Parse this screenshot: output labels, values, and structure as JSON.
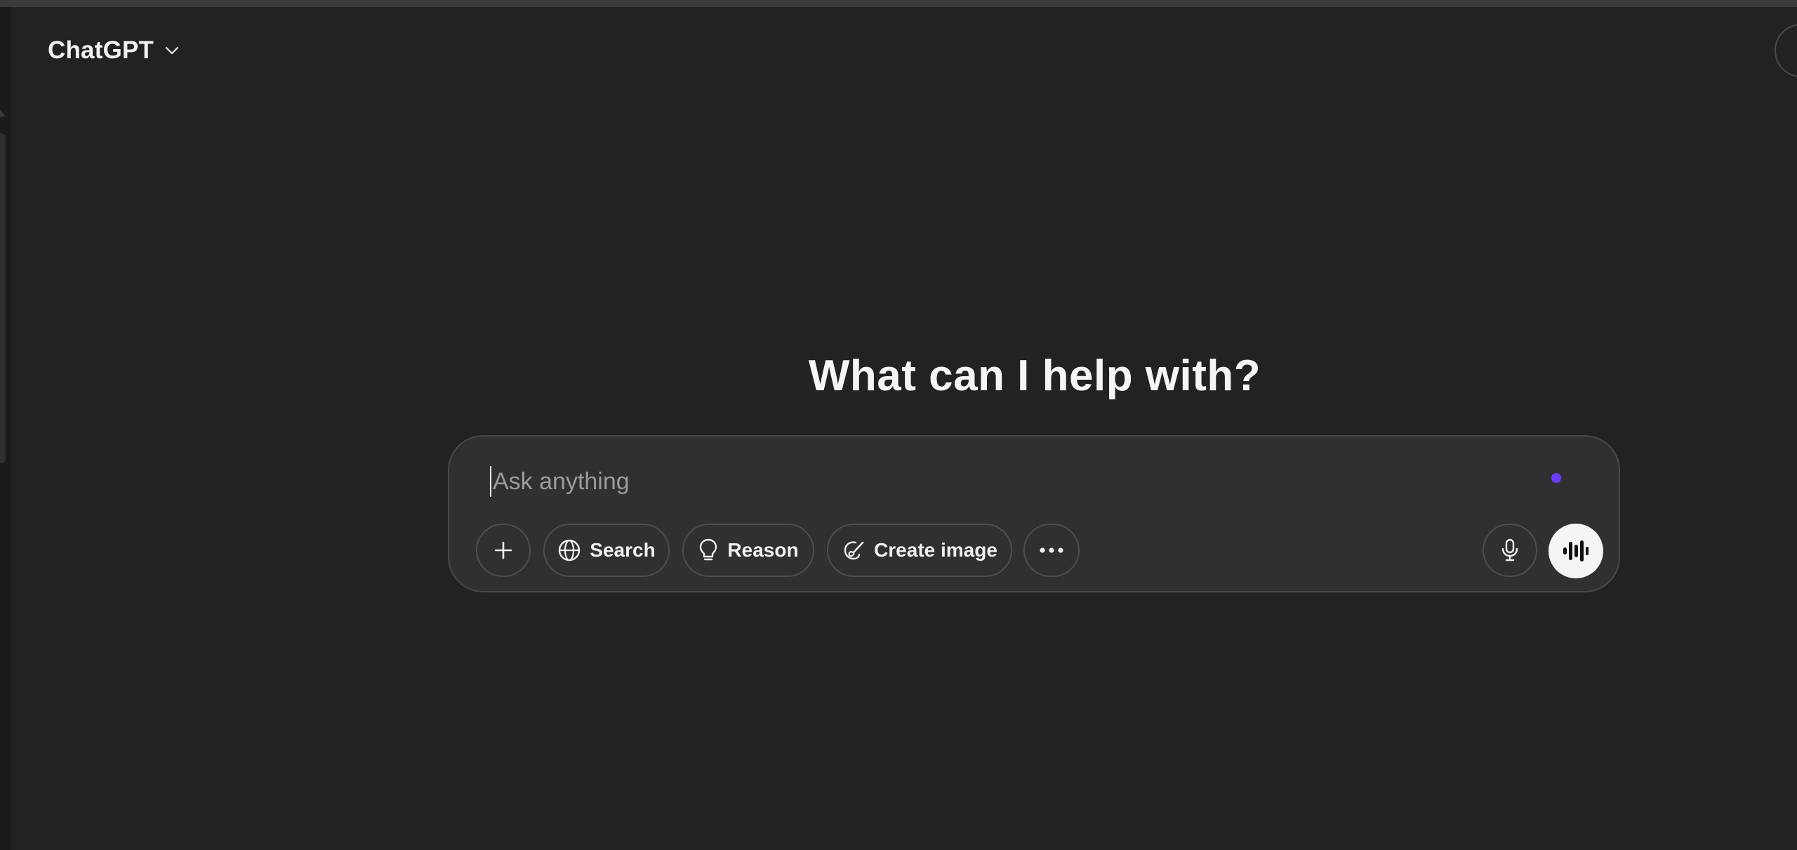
{
  "header": {
    "model_name": "ChatGPT",
    "model_dropdown_icon": "chevron-down-icon"
  },
  "main": {
    "title": "What can I help with?"
  },
  "composer": {
    "placeholder": "Ask anything",
    "buttons": {
      "attach_icon": "plus-icon",
      "search_label": "Search",
      "search_icon": "globe-icon",
      "reason_label": "Reason",
      "reason_icon": "lightbulb-icon",
      "create_image_label": "Create image",
      "create_image_icon": "paintbrush-icon",
      "more_icon": "more-dots-icon",
      "dictate_icon": "microphone-icon",
      "voice_icon": "voice-waveform-icon"
    }
  },
  "colors": {
    "background": "#222124",
    "composer_bg": "#303032",
    "accent_dot": "#6b3bff",
    "voice_button_bg": "#f5f5f5"
  }
}
